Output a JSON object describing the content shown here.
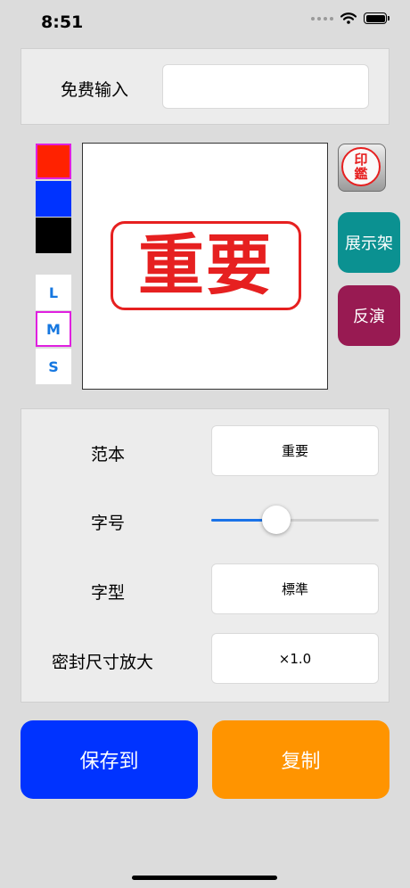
{
  "status_bar": {
    "time": "8:51"
  },
  "free_input": {
    "label": "免费输入",
    "value": ""
  },
  "colors": {
    "red": "#ff2200",
    "blue": "#0033ff",
    "black": "#000000",
    "selected": "red"
  },
  "sizes": {
    "options": [
      "L",
      "M",
      "S"
    ],
    "selected": "M"
  },
  "stamp": {
    "text": "重要",
    "color": "#e62020"
  },
  "side": {
    "logo_text_1": "印",
    "logo_text_2": "鑑",
    "showcase_label": "展示架",
    "invert_label": "反演"
  },
  "settings": {
    "template_label": "范本",
    "template_value": "重要",
    "font_size_label": "字号",
    "font_size_slider_fraction": 0.39,
    "font_style_label": "字型",
    "font_style_value": "標準",
    "seal_scale_label": "密封尺寸放大",
    "seal_scale_value": "×1.0"
  },
  "actions": {
    "save_label": "保存到",
    "copy_label": "复制"
  }
}
